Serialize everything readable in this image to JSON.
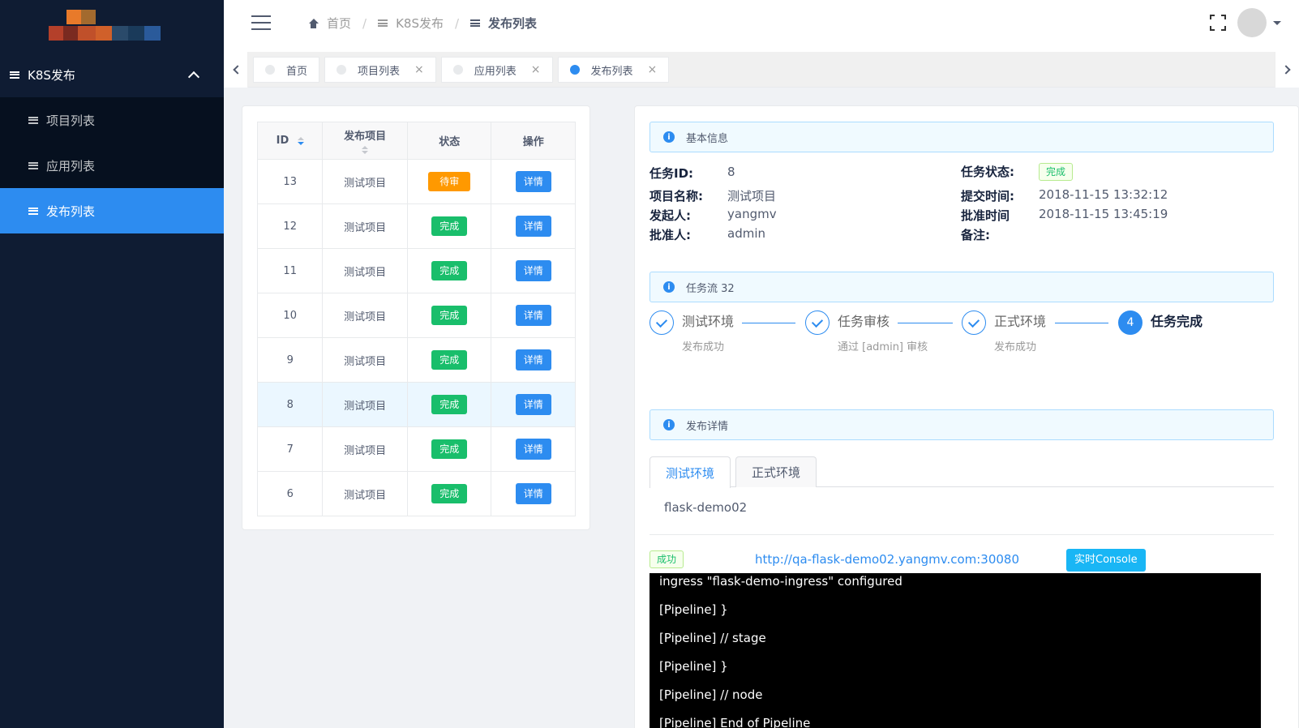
{
  "sidebar": {
    "menu_title": "K8S发布",
    "items": [
      {
        "label": "项目列表"
      },
      {
        "label": "应用列表"
      },
      {
        "label": "发布列表"
      }
    ]
  },
  "header": {
    "breadcrumb": [
      {
        "label": "首页",
        "icon": "home-icon"
      },
      {
        "label": "K8S发布",
        "icon": "menu-icon"
      },
      {
        "label": "发布列表",
        "icon": "menu-icon"
      }
    ]
  },
  "tabs": [
    {
      "label": "首页",
      "closable": false,
      "active": false
    },
    {
      "label": "项目列表",
      "closable": true,
      "active": false
    },
    {
      "label": "应用列表",
      "closable": true,
      "active": false
    },
    {
      "label": "发布列表",
      "closable": true,
      "active": true
    }
  ],
  "table": {
    "columns": [
      "ID",
      "发布项目",
      "状态",
      "操作"
    ],
    "rows": [
      {
        "id": "13",
        "project": "测试项目",
        "status": "待审",
        "action": "详情"
      },
      {
        "id": "12",
        "project": "测试项目",
        "status": "完成",
        "action": "详情"
      },
      {
        "id": "11",
        "project": "测试项目",
        "status": "完成",
        "action": "详情"
      },
      {
        "id": "10",
        "project": "测试项目",
        "status": "完成",
        "action": "详情"
      },
      {
        "id": "9",
        "project": "测试项目",
        "status": "完成",
        "action": "详情"
      },
      {
        "id": "8",
        "project": "测试项目",
        "status": "完成",
        "action": "详情"
      },
      {
        "id": "7",
        "project": "测试项目",
        "status": "完成",
        "action": "详情"
      },
      {
        "id": "6",
        "project": "测试项目",
        "status": "完成",
        "action": "详情"
      }
    ]
  },
  "detail": {
    "basic_title": "基本信息",
    "fields": {
      "task_id_label": "任务ID:",
      "task_id": "8",
      "project_label": "项目名称:",
      "project": "测试项目",
      "initiator_label": "发起人:",
      "initiator": "yangmv",
      "approver_label": "批准人:",
      "approver": "admin",
      "status_label": "任务状态:",
      "status": "完成",
      "submit_label": "提交时间:",
      "submit_time": "2018-11-15 13:32:12",
      "approve_label": "批准时间",
      "approve_time": "2018-11-15 13:45:19",
      "remark_label": "备注:"
    },
    "flow_title": "任务流 32",
    "steps": [
      {
        "title": "测试环境",
        "desc": "发布成功"
      },
      {
        "title": "任务审核",
        "desc": "通过 [admin] 审核"
      },
      {
        "title": "正式环境",
        "desc": "发布成功"
      },
      {
        "num": "4",
        "title": "任务完成",
        "desc": ""
      }
    ],
    "publish_title": "发布详情",
    "env_tabs": [
      "测试环境",
      "正式环境"
    ],
    "app_name": "flask-demo02",
    "result": "成功",
    "url": "http://qa-flask-demo02.yangmv.com:30080",
    "console_button": "实时Console",
    "console_lines": [
      "ingress \"flask-demo-ingress\" configured",
      "[Pipeline] }",
      "[Pipeline] // stage",
      "[Pipeline] }",
      "[Pipeline] // node",
      "[Pipeline] End of Pipeline"
    ]
  },
  "colors": {
    "sidebar_bg": "#0f1c33",
    "primary": "#2d8cf0",
    "success": "#19be6b",
    "warning": "#ff9900"
  }
}
